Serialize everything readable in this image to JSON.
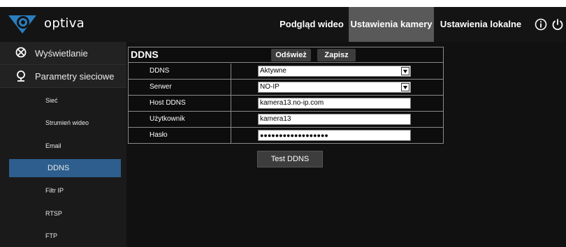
{
  "header": {
    "logo_text": "optiva",
    "nav": [
      {
        "label": "Podgląd wideo"
      },
      {
        "label": "Ustawienia kamery"
      },
      {
        "label": "Ustawienia lokalne"
      }
    ],
    "icons": [
      "info-icon",
      "power-icon"
    ],
    "colors": {
      "bg": "#141414",
      "active_tab": "#595959",
      "logo_blue": "#2a7fc1"
    }
  },
  "sidebar": {
    "main_items": [
      {
        "label": "Wyświetlanie",
        "icon": "display-settings-icon"
      },
      {
        "label": "Parametry sieciowe",
        "icon": "network-icon"
      }
    ],
    "sub_items": [
      {
        "label": "Sieć"
      },
      {
        "label": "Strumień wideo"
      },
      {
        "label": "Email"
      },
      {
        "label": "DDNS"
      },
      {
        "label": "Filtr IP"
      },
      {
        "label": "RTSP"
      },
      {
        "label": "FTP"
      }
    ],
    "active_sub": "DDNS",
    "active_color": "#2d5e8e"
  },
  "panel": {
    "title": "DDNS",
    "refresh_label": "Odśwież",
    "save_label": "Zapisz",
    "rows": [
      {
        "label": "DDNS",
        "value": "Aktywne",
        "type": "select"
      },
      {
        "label": "Serwer",
        "value": "NO-IP",
        "type": "select"
      },
      {
        "label": "Host DDNS",
        "value": "kamera13.no-ip.com",
        "type": "text"
      },
      {
        "label": "Użytkownik",
        "value": "kamera13",
        "type": "text"
      },
      {
        "label": "Hasło",
        "value": "●●●●●●●●●●●●●●●●●●",
        "type": "password"
      }
    ],
    "test_label": "Test DDNS"
  }
}
